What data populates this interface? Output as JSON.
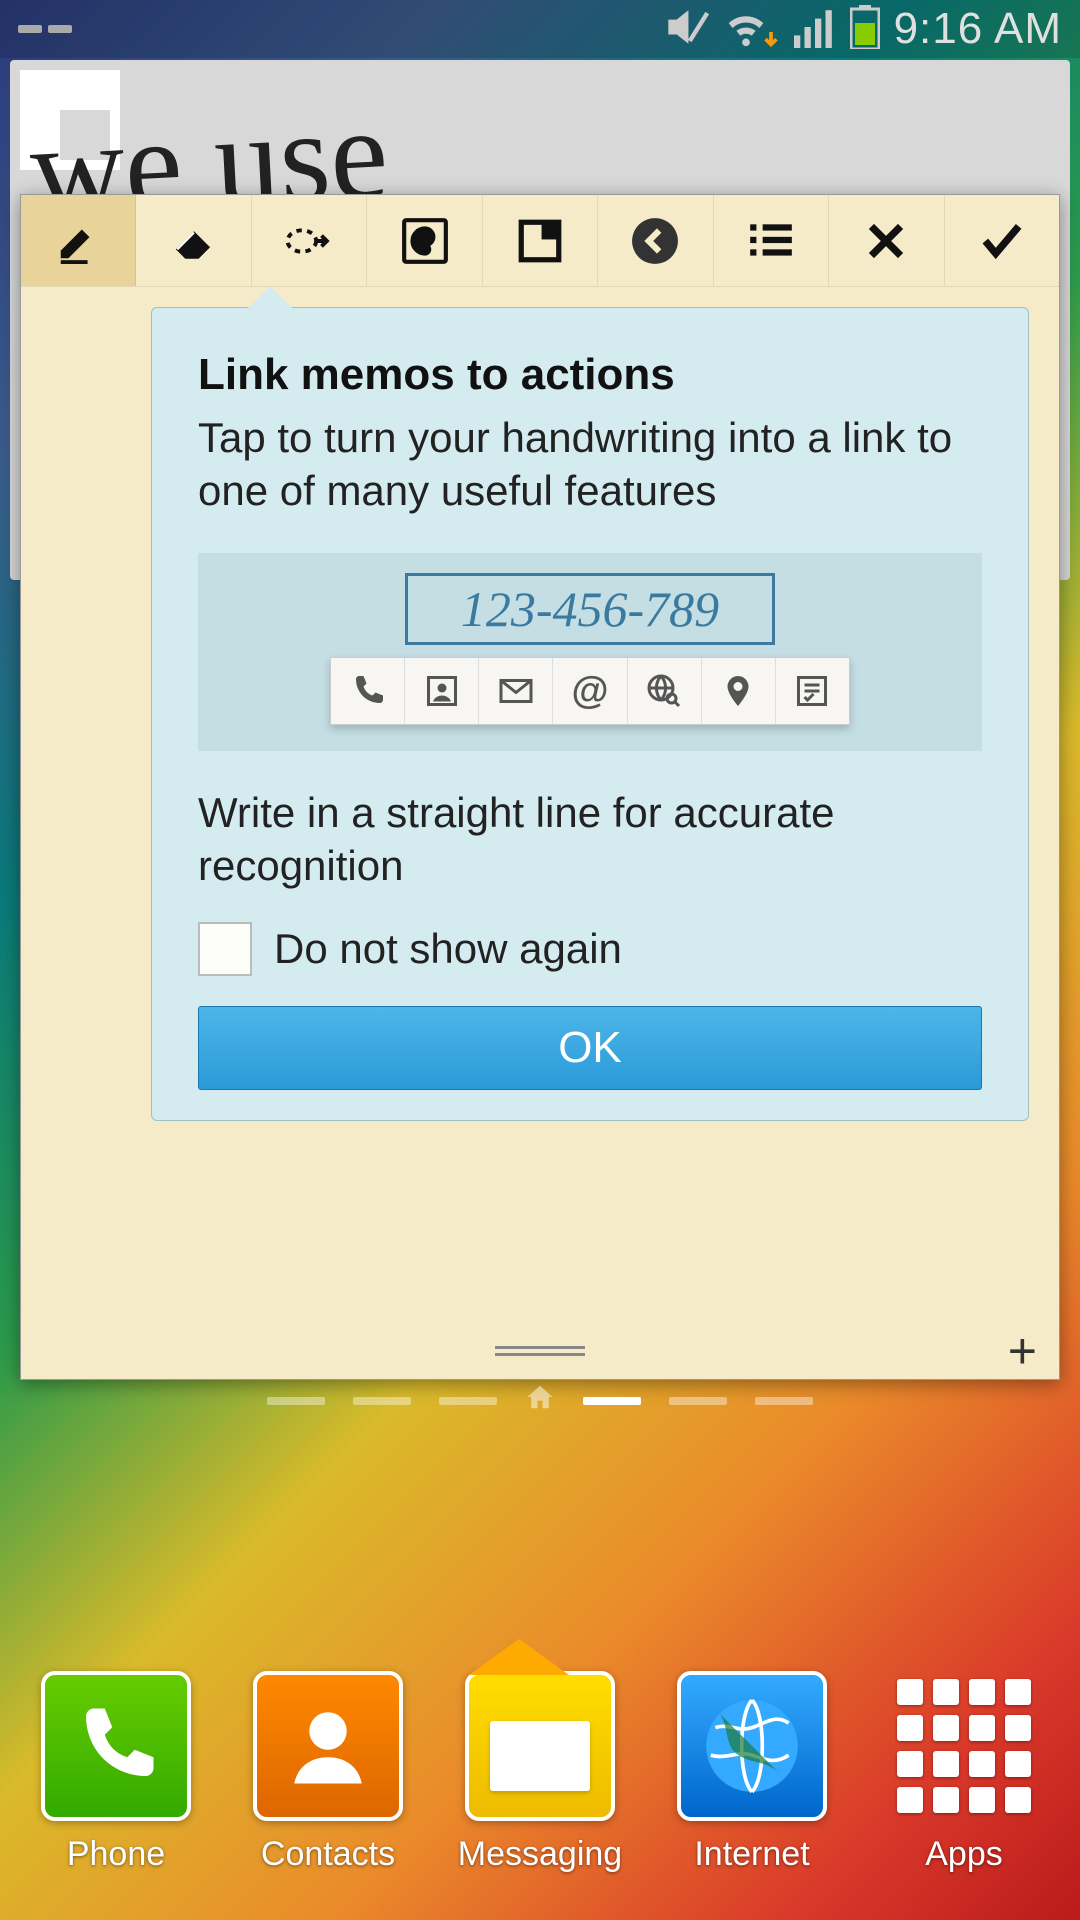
{
  "status": {
    "time": "9:16 AM"
  },
  "tooltip": {
    "title": "Link memos to actions",
    "desc": "Tap to turn your handwriting into a link to one of many useful features",
    "example_text": "123-456-789",
    "tip": "Write in a straight line for accurate recognition",
    "checkbox_label": "Do not show again",
    "ok_label": "OK"
  },
  "dock": {
    "phone": "Phone",
    "contacts": "Contacts",
    "messaging": "Messaging",
    "internet": "Internet",
    "apps": "Apps"
  }
}
